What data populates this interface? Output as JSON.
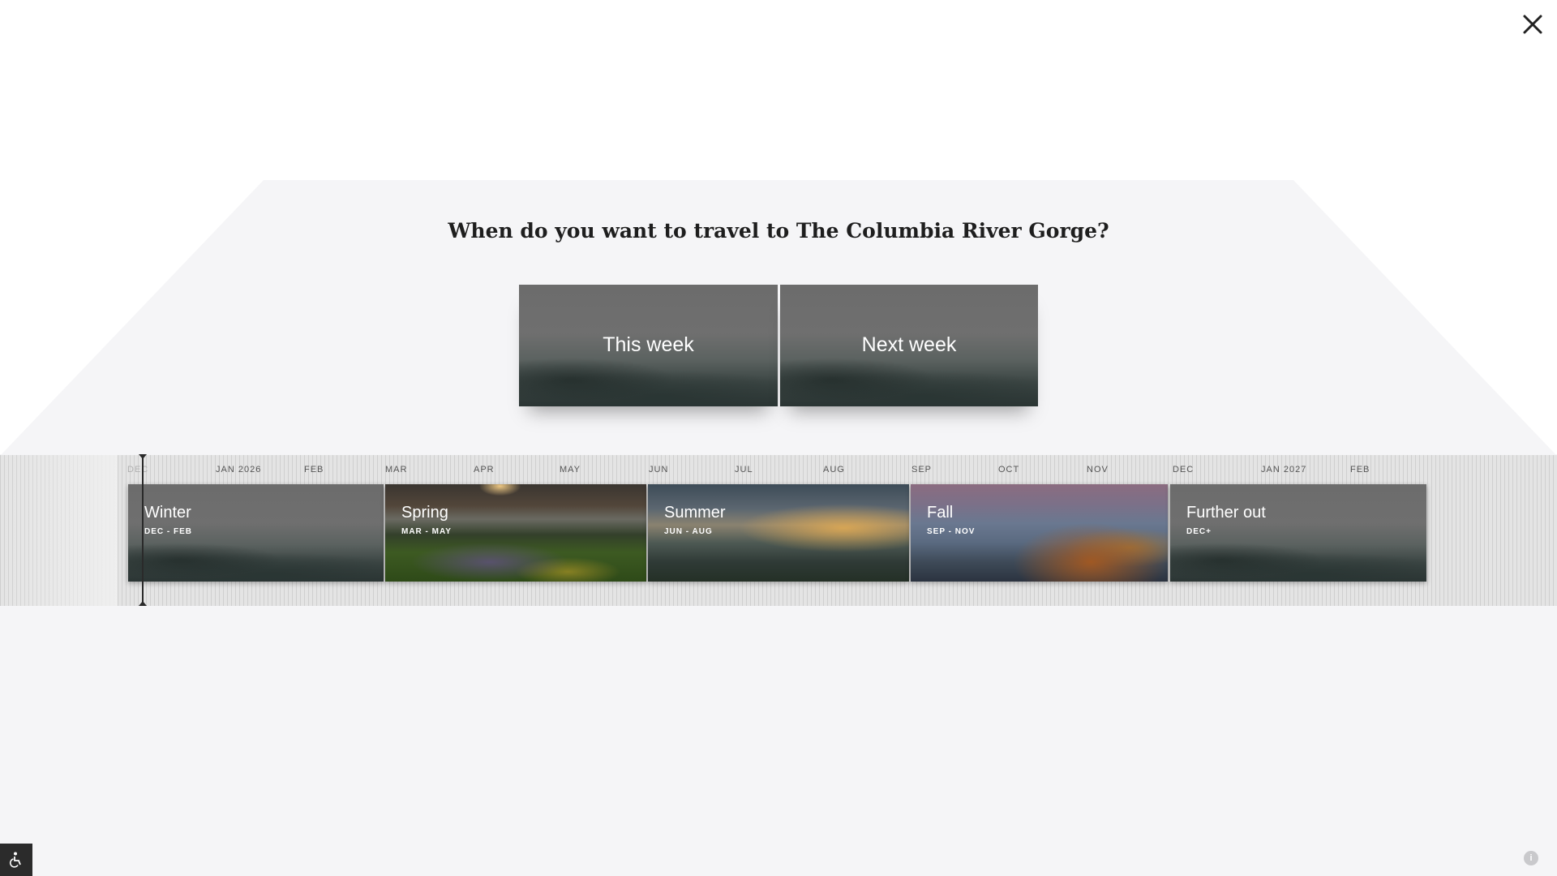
{
  "header": {
    "close_icon": "close-icon",
    "question": "When do you want to travel to The Columbia River Gorge?"
  },
  "quick_options": [
    {
      "label": "This week"
    },
    {
      "label": "Next week"
    }
  ],
  "timeline": {
    "months": [
      "DEC",
      "JAN 2026",
      "FEB",
      "MAR",
      "APR",
      "MAY",
      "JUN",
      "JUL",
      "AUG",
      "SEP",
      "OCT",
      "NOV",
      "DEC",
      "JAN 2027",
      "FEB"
    ],
    "seasons": [
      {
        "name": "Winter",
        "range": "DEC - FEB"
      },
      {
        "name": "Spring",
        "range": "MAR - MAY"
      },
      {
        "name": "Summer",
        "range": "JUN - AUG"
      },
      {
        "name": "Fall",
        "range": "SEP - NOV"
      },
      {
        "name": "Further out",
        "range": "DEC+"
      }
    ]
  },
  "footer": {
    "accessibility_icon": "accessibility-icon",
    "info_icon": "info-icon",
    "info_glyph": "i"
  },
  "colors": {
    "background": "#f5f5f7",
    "timeline": "#e4e4e4",
    "text": "#1e1e1e"
  }
}
